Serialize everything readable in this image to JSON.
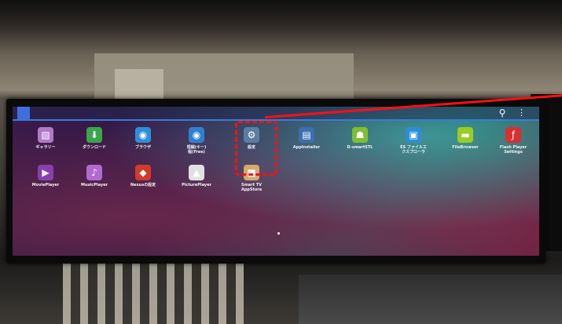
{
  "launcher": {
    "row1": [
      {
        "label": "ギャラリー",
        "icon": "gallery-icon",
        "color": "#b07ac8"
      },
      {
        "label": "ダウンロード",
        "icon": "download-icon",
        "color": "#3aa54a"
      },
      {
        "label": "ブラウザ",
        "icon": "browser-globe-icon",
        "color": "#2f8ed8"
      },
      {
        "label": "短縮(キー)\n程(Free)",
        "icon": "globe-icon",
        "color": "#2f7fd0"
      },
      {
        "label": "設定",
        "icon": "settings-icon",
        "color": "#5a7ea0"
      },
      {
        "label": "AppInstaller",
        "icon": "app-installer-icon",
        "color": "#3c6fb0"
      },
      {
        "label": "D-smartSTL",
        "icon": "android-icon",
        "color": "#7fbf30"
      },
      {
        "label": "ES ファイルエ\nクスプローラ",
        "icon": "es-explorer-icon",
        "color": "#2b8fd6"
      },
      {
        "label": "FileBrowser",
        "icon": "folder-icon",
        "color": "#9acc26"
      },
      {
        "label": "Flash Player\nSettings",
        "icon": "flash-icon",
        "color": "#d83030"
      }
    ],
    "row2": [
      {
        "label": "MoviePlayer",
        "icon": "movie-icon",
        "color": "#8a3fb0"
      },
      {
        "label": "MusicPlayer",
        "icon": "music-icon",
        "color": "#b06ad0"
      },
      {
        "label": "Nexusの設定",
        "icon": "nexus-settings-icon",
        "color": "#d23a2a"
      },
      {
        "label": "PicturePlayer",
        "icon": "picture-icon",
        "color": "#e0e0e0"
      },
      {
        "label": "Smart TV\nAppStore",
        "icon": "appstore-bag-icon",
        "color": "#d9a86a"
      }
    ]
  },
  "topbar": {
    "search_glyph": "⚲",
    "menu_glyph": "⋮",
    "accent": "#3a7bd5"
  },
  "highlight_color": "#ff1010"
}
